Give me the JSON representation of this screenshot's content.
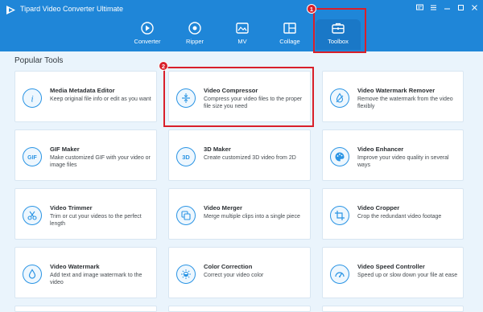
{
  "app": {
    "title": "Tipard Video Converter Ultimate"
  },
  "nav": {
    "tabs": [
      {
        "label": "Converter",
        "icon": "converter-icon"
      },
      {
        "label": "Ripper",
        "icon": "ripper-icon"
      },
      {
        "label": "MV",
        "icon": "mv-icon"
      },
      {
        "label": "Collage",
        "icon": "collage-icon"
      },
      {
        "label": "Toolbox",
        "icon": "toolbox-icon",
        "active": true
      }
    ]
  },
  "callouts": {
    "toolbox_badge": "1",
    "compressor_badge": "2"
  },
  "section": {
    "title": "Popular Tools"
  },
  "tools": [
    {
      "name": "Media Metadata Editor",
      "desc": "Keep original file info or edit as you want",
      "icon": "info-icon"
    },
    {
      "name": "Video Compressor",
      "desc": "Compress your video files to the proper file size you need",
      "icon": "compress-icon"
    },
    {
      "name": "Video Watermark Remover",
      "desc": "Remove the watermark from the video flexibly",
      "icon": "drop-remove-icon"
    },
    {
      "name": "GIF Maker",
      "desc": "Make customized GIF with your video or image files",
      "icon": "gif-icon"
    },
    {
      "name": "3D Maker",
      "desc": "Create customized 3D video from 2D",
      "icon": "3d-icon"
    },
    {
      "name": "Video Enhancer",
      "desc": "Improve your video quality in several ways",
      "icon": "palette-icon"
    },
    {
      "name": "Video Trimmer",
      "desc": "Trim or cut your videos to the perfect length",
      "icon": "scissors-icon"
    },
    {
      "name": "Video Merger",
      "desc": "Merge multiple clips into a single piece",
      "icon": "merge-icon"
    },
    {
      "name": "Video Cropper",
      "desc": "Crop the redundant video footage",
      "icon": "crop-icon"
    },
    {
      "name": "Video Watermark",
      "desc": "Add text and image watermark to the video",
      "icon": "drop-icon"
    },
    {
      "name": "Color Correction",
      "desc": "Correct your video color",
      "icon": "sun-icon"
    },
    {
      "name": "Video Speed Controller",
      "desc": "Speed up or slow down your file at ease",
      "icon": "speed-icon"
    }
  ],
  "colors": {
    "header": "#1f86d8",
    "accent": "#2a94e4",
    "callout": "#d9202a",
    "background": "#eaf4fc"
  }
}
